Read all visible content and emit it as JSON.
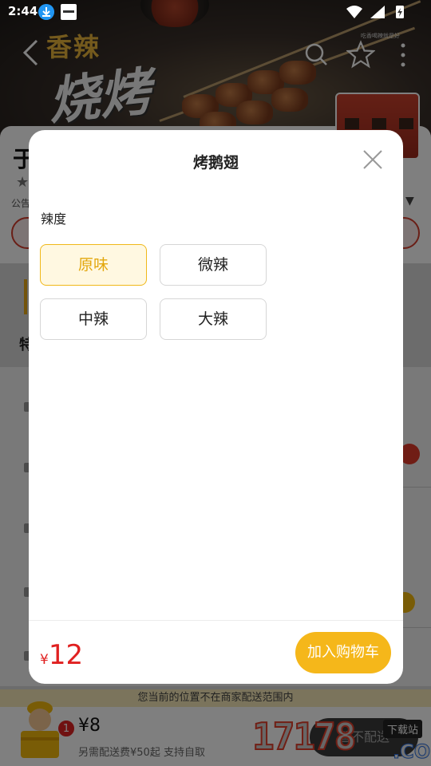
{
  "status_bar": {
    "time": "2:44"
  },
  "hero": {
    "title_top": "香辣",
    "title_big": "烧烤",
    "caption": "吃香喝辣就是好"
  },
  "shop": {
    "name_partial": "于",
    "notice_partial": "公告",
    "side_category_partial": "特"
  },
  "modal": {
    "title": "烤鹅翅",
    "section_label": "辣度",
    "options": [
      "原味",
      "微辣",
      "中辣",
      "大辣"
    ],
    "selected_index": 0,
    "price_currency": "¥",
    "price": "12",
    "add_to_cart_label": "加入购物车"
  },
  "delivery_notice": "您当前的位置不在商家配送范围内",
  "cart": {
    "badge_count": "1",
    "total": "¥8",
    "subtitle": "另需配送费¥50起  支持自取",
    "button_label": "暂不配送"
  },
  "watermark": {
    "number": "17178",
    "domain": ".COM",
    "tag": "下载站"
  },
  "colors": {
    "accent_yellow": "#f5b71a",
    "selected_bg": "#fff8e1",
    "selected_text": "#e3a70d",
    "price_red": "#e02020"
  },
  "icons": {
    "back": "chevron-left-icon",
    "search": "search-icon",
    "favorite": "star-icon",
    "more": "more-vertical-icon",
    "close": "close-icon"
  }
}
